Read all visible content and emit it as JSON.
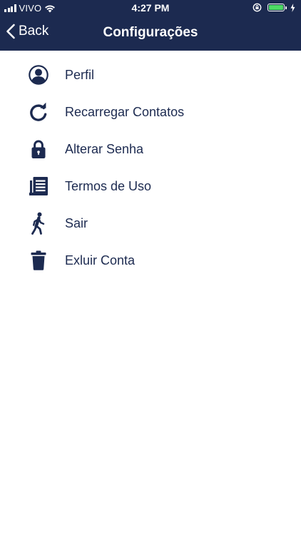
{
  "status_bar": {
    "carrier": "VIVO",
    "time": "4:27 PM"
  },
  "nav": {
    "back_label": "Back",
    "title": "Configurações"
  },
  "menu": {
    "items": [
      {
        "label": "Perfil",
        "icon": "profile-icon"
      },
      {
        "label": "Recarregar Contatos",
        "icon": "refresh-icon"
      },
      {
        "label": "Alterar Senha",
        "icon": "lock-icon"
      },
      {
        "label": "Termos de Uso",
        "icon": "document-icon"
      },
      {
        "label": "Sair",
        "icon": "walking-person-icon"
      },
      {
        "label": "Exluir Conta",
        "icon": "trash-icon"
      }
    ]
  },
  "colors": {
    "header_bg": "#1c2a50",
    "accent": "#1c2a50",
    "battery": "#4cd964"
  }
}
